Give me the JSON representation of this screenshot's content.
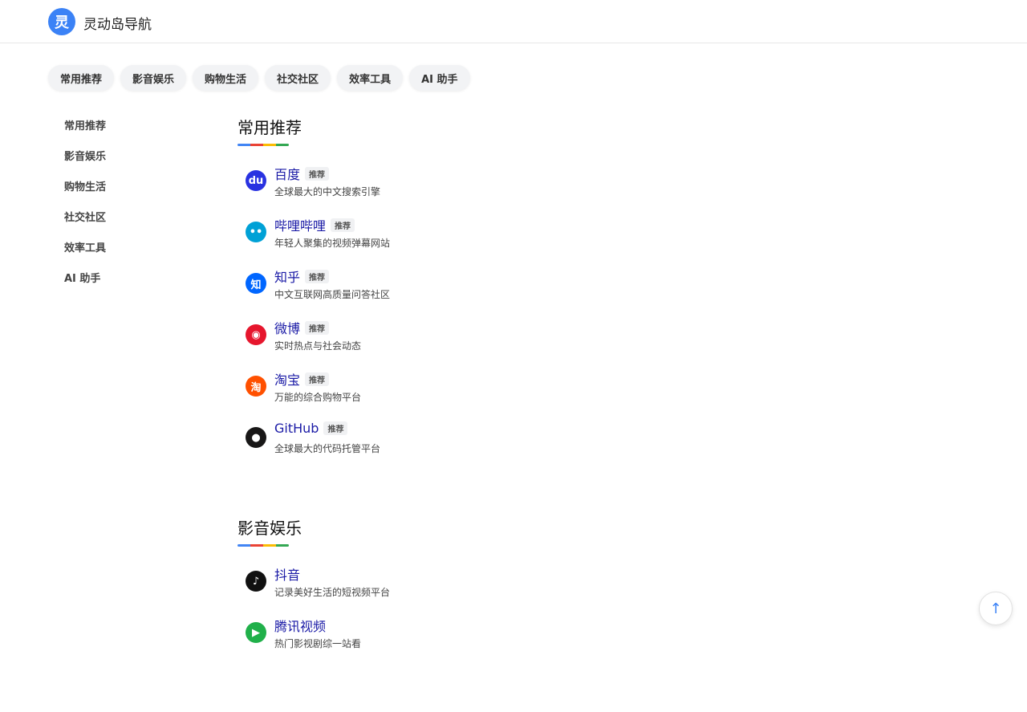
{
  "header": {
    "logo_char": "灵",
    "title": "灵动岛导航",
    "logo_color": "#3b82f6"
  },
  "tabs": [
    "常用推荐",
    "影音娱乐",
    "购物生活",
    "社交社区",
    "效率工具",
    "AI 助手"
  ],
  "sidenav": [
    "常用推荐",
    "影音娱乐",
    "购物生活",
    "社交社区",
    "效率工具",
    "AI 助手"
  ],
  "underline_colors": [
    "#4285f4",
    "#ea4335",
    "#fbbc05",
    "#34a853"
  ],
  "sections": [
    {
      "title": "常用推荐",
      "items": [
        {
          "name": "百度",
          "badge": "推荐",
          "desc": "全球最大的中文搜索引擎",
          "icon": "baidu-icon",
          "glyph": "du",
          "color": "#2932e1"
        },
        {
          "name": "哔哩哔哩",
          "badge": "推荐",
          "desc": "年轻人聚集的视频弹幕网站",
          "icon": "bilibili-icon",
          "glyph": "••",
          "color": "#00a1d6"
        },
        {
          "name": "知乎",
          "badge": "推荐",
          "desc": "中文互联网高质量问答社区",
          "icon": "zhihu-icon",
          "glyph": "知",
          "color": "#0066ff"
        },
        {
          "name": "微博",
          "badge": "推荐",
          "desc": "实时热点与社会动态",
          "icon": "weibo-icon",
          "glyph": "◉",
          "color": "#e6162d"
        },
        {
          "name": "淘宝",
          "badge": "推荐",
          "desc": "万能的综合购物平台",
          "icon": "taobao-icon",
          "glyph": "淘",
          "color": "#ff5000"
        },
        {
          "name": "GitHub",
          "badge": "推荐",
          "desc": "全球最大的代码托管平台",
          "icon": "github-icon",
          "glyph": "●",
          "color": "#181717"
        }
      ]
    },
    {
      "title": "影音娱乐",
      "items": [
        {
          "name": "抖音",
          "badge": "",
          "desc": "记录美好生活的短视频平台",
          "icon": "douyin-icon",
          "glyph": "♪",
          "color": "#111111"
        },
        {
          "name": "腾讯视频",
          "badge": "",
          "desc": "热门影视剧综一站看",
          "icon": "tencent-video-icon",
          "glyph": "▶",
          "color": "#20b04a"
        }
      ]
    }
  ],
  "back_to_top": "↑"
}
